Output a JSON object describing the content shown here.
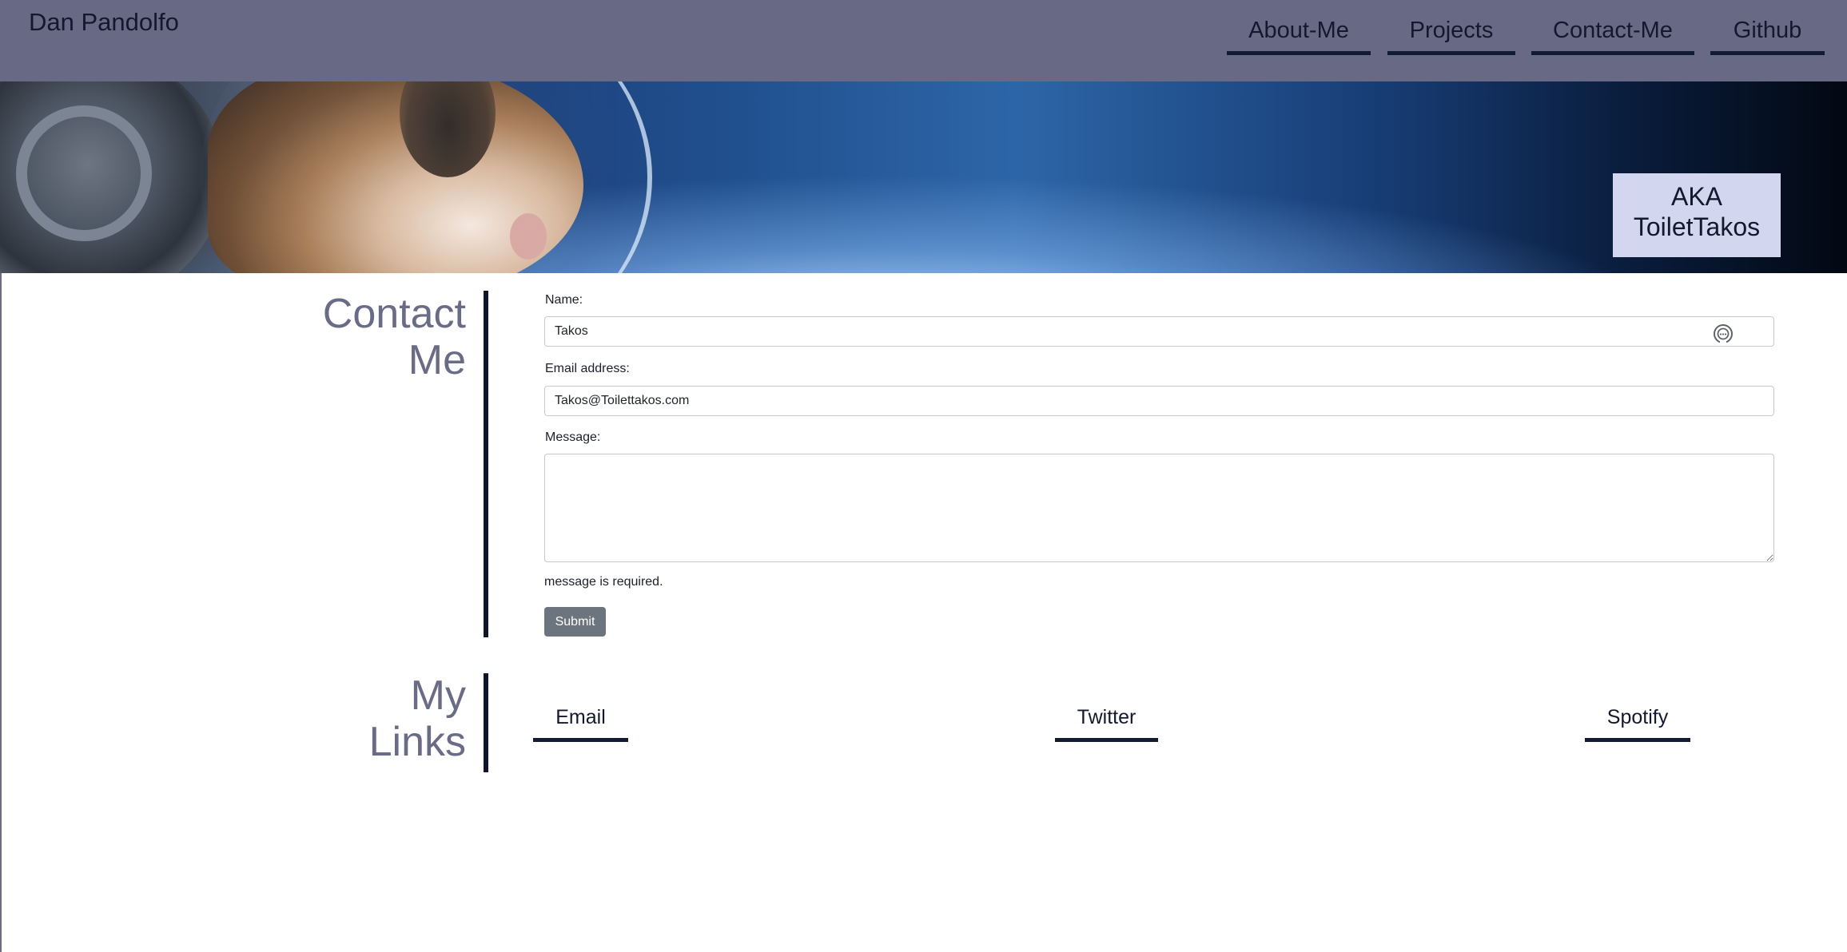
{
  "header": {
    "brand": "Dan Pandolfo",
    "nav": [
      "About-Me",
      "Projects",
      "Contact-Me",
      "Github"
    ]
  },
  "hero": {
    "aka_line1": "AKA",
    "aka_line2": "ToiletTakos"
  },
  "contact": {
    "title_line1": "Contact",
    "title_line2": "Me",
    "name_label": "Name:",
    "name_value": "Takos",
    "email_label": "Email address:",
    "email_value": "Takos@Toilettakos.com",
    "message_label": "Message:",
    "message_value": "",
    "error": "message is required.",
    "submit_label": "Submit"
  },
  "links": {
    "title_line1": "My",
    "title_line2": "Links",
    "items": [
      "Email",
      "Twitter",
      "Spotify"
    ]
  },
  "colors": {
    "header_bg": "#686a85",
    "accent_dark": "#131a33",
    "title_gray": "#6a6b86",
    "aka_bg": "#d2d6ee",
    "submit_bg": "#6c757d"
  },
  "icons": {
    "autofill": "password-manager-icon"
  }
}
